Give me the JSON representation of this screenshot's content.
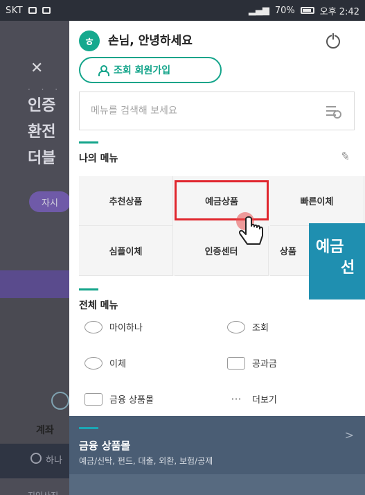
{
  "status_bar": {
    "carrier": "SKT",
    "battery": "70%",
    "time": "오후 2:42"
  },
  "background_app": {
    "lines": [
      "인증",
      "환전",
      "더블"
    ],
    "pill": "자시",
    "account": "계좌",
    "bottom_item": "하나",
    "bottom_text": "지인사진"
  },
  "menu": {
    "greeting": "손님, 안녕하세요",
    "signup_button": "조회 회원가입",
    "search": {
      "placeholder": "메뉴를 검색해 보세요"
    },
    "my_menu": {
      "title": "나의 메뉴",
      "items": [
        {
          "label": "추천상품"
        },
        {
          "label": "예금상품"
        },
        {
          "label": "빠른이체"
        },
        {
          "label": "심플이체"
        },
        {
          "label": "인증센터"
        },
        {
          "label": "상품"
        }
      ]
    },
    "all_menu": {
      "title": "전체 메뉴",
      "items": [
        {
          "label": "마이하나",
          "icon": "smile-face-icon"
        },
        {
          "label": "조회",
          "icon": "speech-bubble-icon"
        },
        {
          "label": "이체",
          "icon": "transfer-arrow-icon"
        },
        {
          "label": "공과금",
          "icon": "envelope-icon"
        },
        {
          "label": "금융 상품몰",
          "icon": "store-icon"
        },
        {
          "label": "더보기",
          "icon": "more-dots-icon"
        }
      ]
    },
    "footer": {
      "title": "금융 상품몰",
      "subtitle": "예금/신탁, 펀드, 대출, 외환, 보험/공제"
    }
  },
  "tooltip": {
    "line1": "예금",
    "line2": "선"
  },
  "colors": {
    "accent": "#13a48a",
    "highlight": "#e0262d",
    "tooltip": "#1f8fb0",
    "footer": "#4a5d74"
  }
}
